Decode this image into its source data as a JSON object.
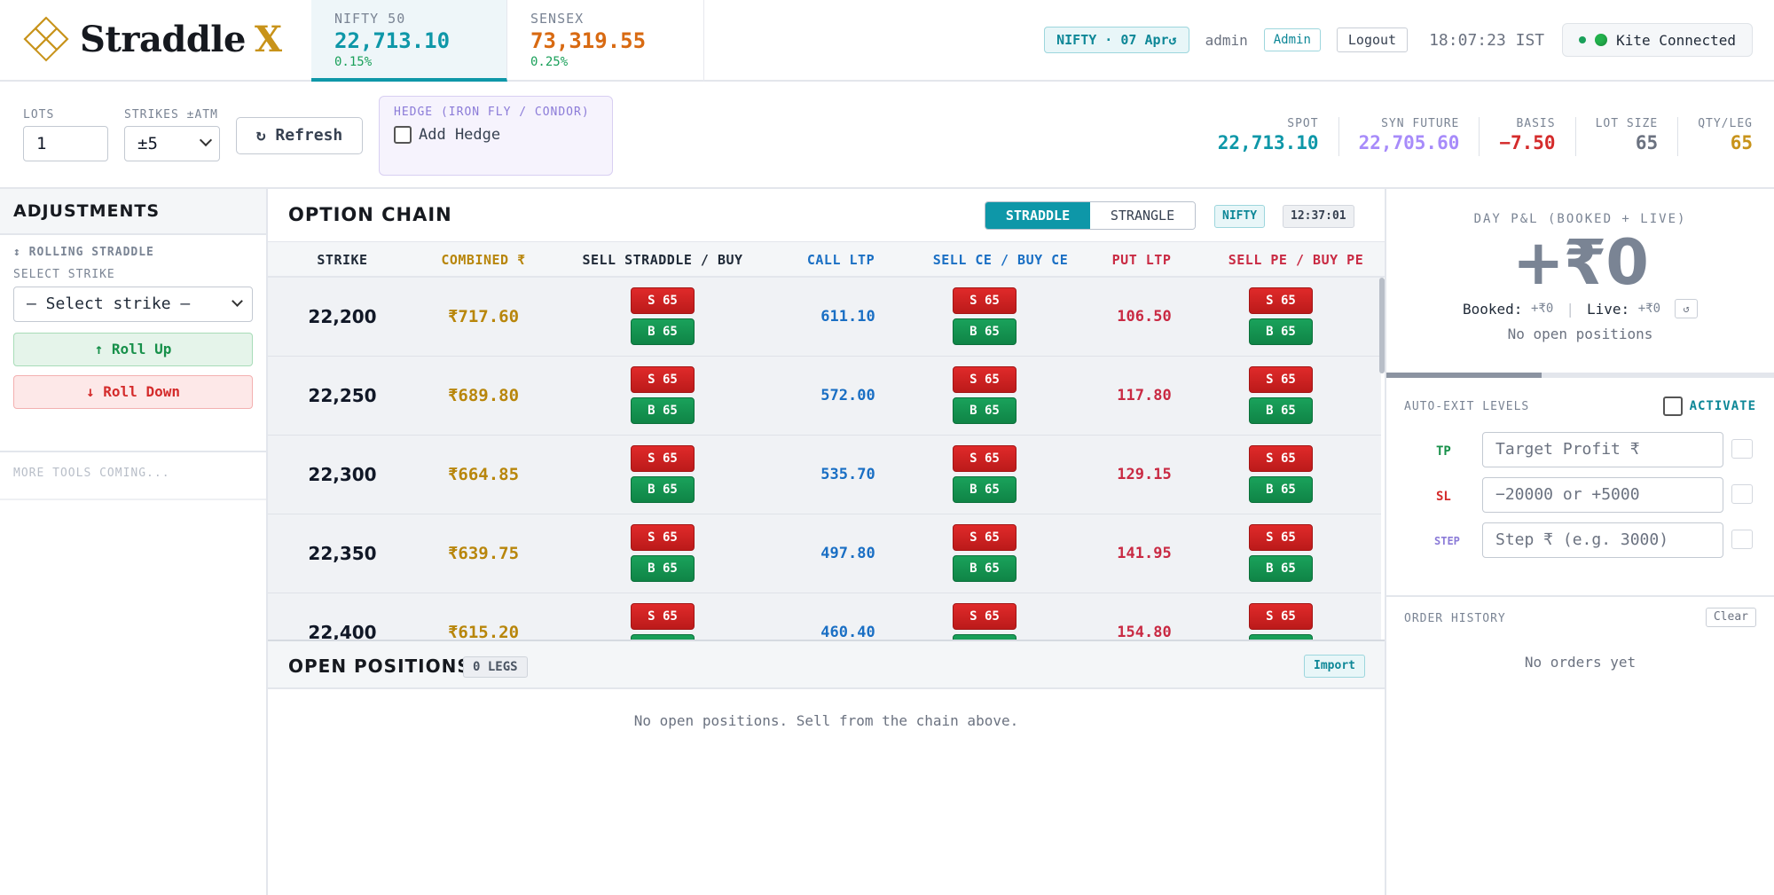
{
  "brand": {
    "name": "Straddle",
    "suffix": "X"
  },
  "tickers": [
    {
      "name": "NIFTY 50",
      "value": "22,713.10",
      "change": "0.15%"
    },
    {
      "name": "SENSEX",
      "value": "73,319.55",
      "change": "0.25%"
    }
  ],
  "header": {
    "expiry": "NIFTY · 07 Apr↺",
    "user": "admin",
    "role": "Admin",
    "logout": "Logout",
    "clock": "18:07:23 IST",
    "kite_status": "Kite Connected"
  },
  "controls": {
    "lots_label": "LOTS",
    "lots_value": "1",
    "strikes_label": "STRIKES ±ATM",
    "strikes_value": "±5",
    "refresh_label": "↻ Refresh",
    "hedge_title": "HEDGE (IRON FLY / CONDOR)",
    "hedge_label": "Add Hedge"
  },
  "stats": [
    {
      "label": "SPOT",
      "value": "22,713.10",
      "color": "#0e97a8"
    },
    {
      "label": "SYN FUTURE",
      "value": "22,705.60",
      "color": "#a78bfa"
    },
    {
      "label": "BASIS",
      "value": "−7.50",
      "color": "#d42b2b"
    },
    {
      "label": "LOT SIZE",
      "value": "65",
      "color": "#6b7280"
    },
    {
      "label": "QTY/LEG",
      "value": "65",
      "color": "#c8931a"
    }
  ],
  "adjustments": {
    "title": "ADJUSTMENTS",
    "subtitle": "↕ ROLLING STRADDLE",
    "select_label": "SELECT STRIKE",
    "select_placeholder": "— Select strike —",
    "roll_up": "↑ Roll Up",
    "roll_down": "↓ Roll Down",
    "more_tools": "MORE TOOLS COMING..."
  },
  "chain": {
    "title": "OPTION CHAIN",
    "mode_active": "STRADDLE",
    "mode_other": "STRANGLE",
    "symbol": "NIFTY",
    "time": "12:37:01",
    "columns": {
      "strike": "STRIKE",
      "combined": "COMBINED ₹",
      "straddle": "SELL STRADDLE / BUY",
      "call": "CALL LTP",
      "ce": "SELL CE / BUY CE",
      "put": "PUT LTP",
      "pe": "SELL PE / BUY PE"
    },
    "sell_label": "S 65",
    "buy_label": "B 65",
    "rows": [
      {
        "strike": "22,200",
        "combined": "₹717.60",
        "call": "611.10",
        "put": "106.50"
      },
      {
        "strike": "22,250",
        "combined": "₹689.80",
        "call": "572.00",
        "put": "117.80"
      },
      {
        "strike": "22,300",
        "combined": "₹664.85",
        "call": "535.70",
        "put": "129.15"
      },
      {
        "strike": "22,350",
        "combined": "₹639.75",
        "call": "497.80",
        "put": "141.95"
      },
      {
        "strike": "22,400",
        "combined": "₹615.20",
        "call": "460.40",
        "put": "154.80"
      }
    ]
  },
  "positions": {
    "title": "OPEN POSITIONS",
    "legs": "0 LEGS",
    "import": "Import",
    "empty": "No open positions. Sell from the chain above."
  },
  "pnl": {
    "title": "DAY P&L (BOOKED + LIVE)",
    "value": "+₹0",
    "booked_label": "Booked:",
    "booked_value": "+₹0",
    "live_label": "Live:",
    "live_value": "+₹0",
    "reset": "↺",
    "note": "No open positions",
    "progress": 0.4
  },
  "autoexit": {
    "title": "AUTO-EXIT LEVELS",
    "activate": "ACTIVATE",
    "rows": [
      {
        "key": "TP",
        "placeholder": "Target Profit ₹",
        "color": "#17904a"
      },
      {
        "key": "SL",
        "placeholder": "−20000 or +5000",
        "color": "#d42b2b"
      },
      {
        "key": "STEP",
        "placeholder": "Step ₹ (e.g. 3000)",
        "color": "#8b7bd8"
      }
    ]
  },
  "history": {
    "title": "ORDER HISTORY",
    "clear": "Clear",
    "empty": "No orders yet"
  }
}
